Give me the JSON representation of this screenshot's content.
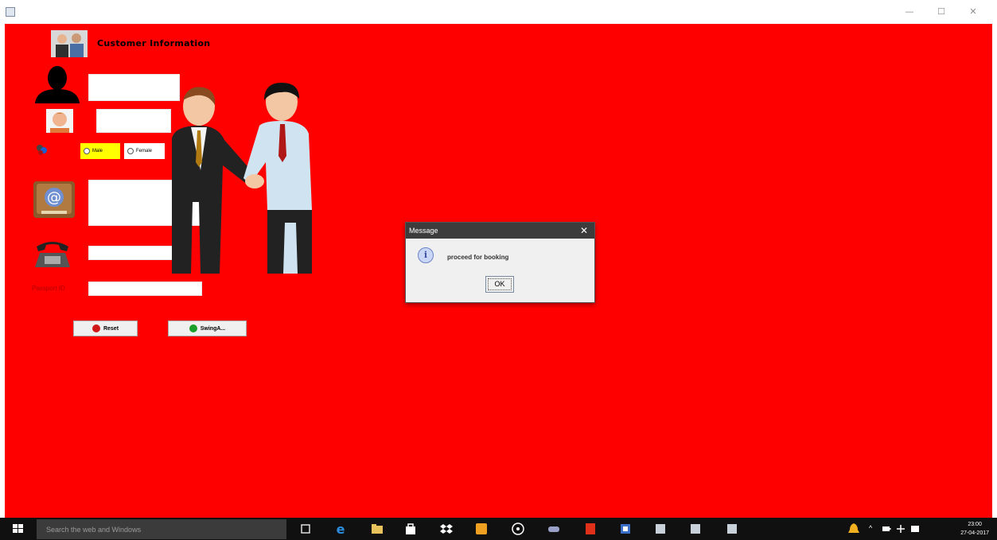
{
  "window": {
    "title": "",
    "minimize_glyph": "—",
    "maximize_glyph": "☐",
    "close_glyph": "✕"
  },
  "form": {
    "title": "Customer Information",
    "gender_male": "Male",
    "gender_female": "Female",
    "passport_label": "Passport ID",
    "reset_label": "Reset",
    "swing_label": "SwingA..."
  },
  "dialog": {
    "title": "Message",
    "message": "proceed for booking",
    "ok_label": "OK",
    "close_glyph": "✕"
  },
  "taskbar": {
    "search_placeholder": "Search the web and Windows",
    "time": "23:00",
    "date": "27-04-2017"
  },
  "colors": {
    "background": "#ff0000",
    "male_highlight": "#ffff00",
    "dialog_title_bar": "#3c3c3c",
    "taskbar": "#101010"
  },
  "icons": [
    "customers-icon",
    "user-silhouette-icon",
    "person-face-icon",
    "gender-icon",
    "email-icon",
    "telephone-icon",
    "reset-icon",
    "swing-icon",
    "info-icon"
  ]
}
